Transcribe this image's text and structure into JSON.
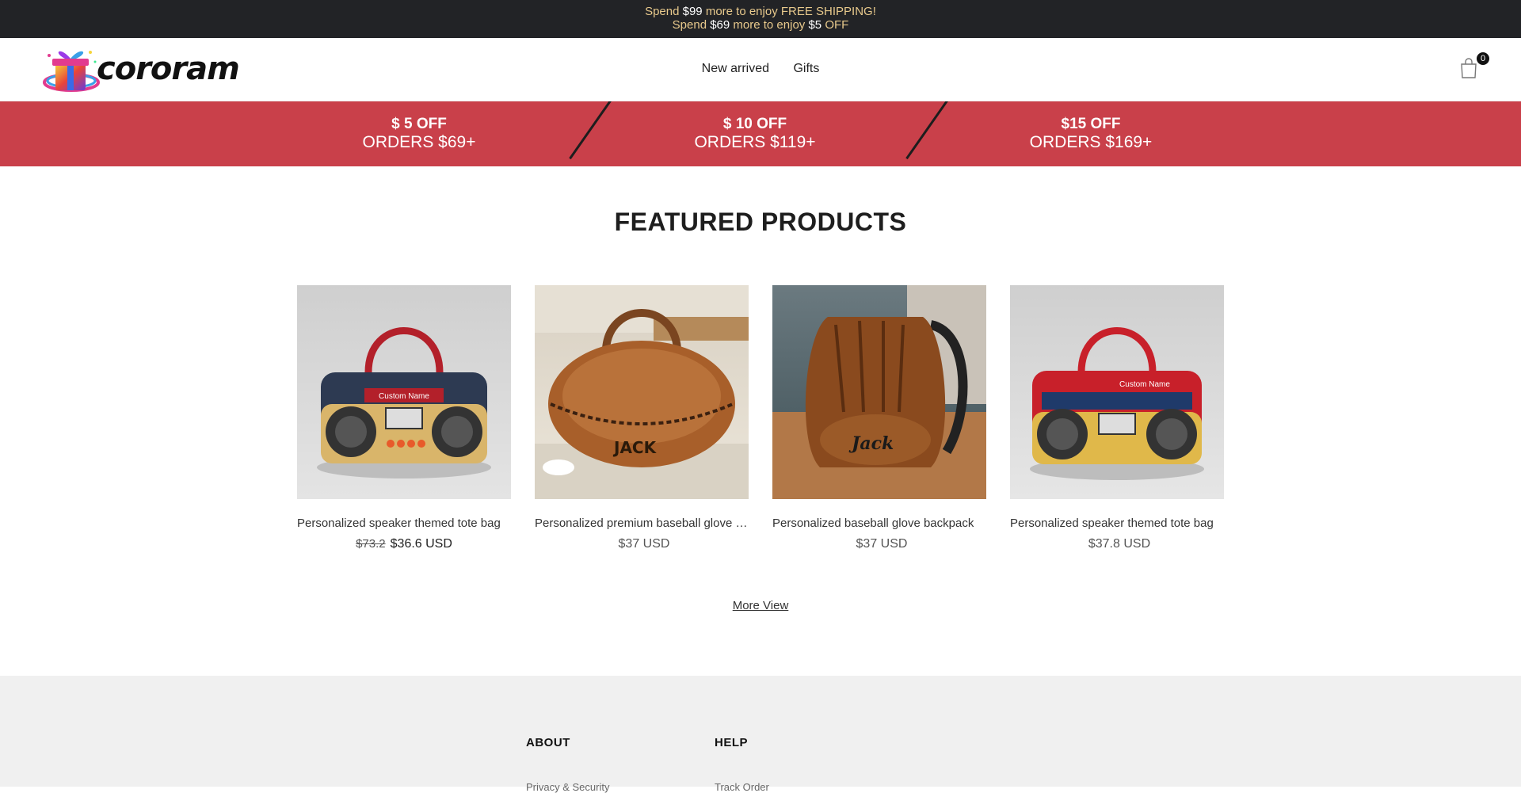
{
  "announcement": {
    "line1_pre": "Spend ",
    "line1_amount": "$99",
    "line1_post": " more to enjoy FREE SHIPPING!",
    "line2_pre": "Spend ",
    "line2_amount": "$69",
    "line2_mid": " more to enjoy ",
    "line2_amount2": "$5",
    "line2_post": " OFF"
  },
  "header": {
    "logo_text": "cororam",
    "nav": [
      "New arrived",
      "Gifts"
    ],
    "cart_count": "0"
  },
  "promo": [
    {
      "top": "$ 5 OFF",
      "bottom": "ORDERS $69+"
    },
    {
      "top": "$ 10 OFF",
      "bottom": "ORDERS $119+"
    },
    {
      "top": "$15 OFF",
      "bottom": "ORDERS $169+"
    }
  ],
  "featured": {
    "title": "FEATURED PRODUCTS",
    "more_label": "More View",
    "products": [
      {
        "title": "Personalized speaker themed tote bag",
        "old_price": "$73.2",
        "price": "$36.6 USD",
        "image": "speaker-tote-bag",
        "personalization": "Custom Name"
      },
      {
        "title": "Personalized premium baseball glove duffel bag",
        "old_price": "",
        "price": "$37 USD",
        "image": "baseball-glove-duffel",
        "personalization": "JACK"
      },
      {
        "title": "Personalized baseball glove backpack",
        "old_price": "",
        "price": "$37 USD",
        "image": "baseball-glove-backpack",
        "personalization": "Jack"
      },
      {
        "title": "Personalized speaker themed tote bag",
        "old_price": "",
        "price": "$37.8 USD",
        "image": "speaker-tote-bag-red",
        "personalization": "Custom Name"
      }
    ]
  },
  "footer": {
    "columns": [
      {
        "heading": "ABOUT",
        "first_link": "Privacy & Security"
      },
      {
        "heading": "HELP",
        "first_link": "Track Order"
      }
    ]
  },
  "colors": {
    "announce_bg": "#222326",
    "announce_text": "#e8c98c",
    "promo_bg": "#c9404a",
    "footer_bg": "#f0f0f0"
  }
}
